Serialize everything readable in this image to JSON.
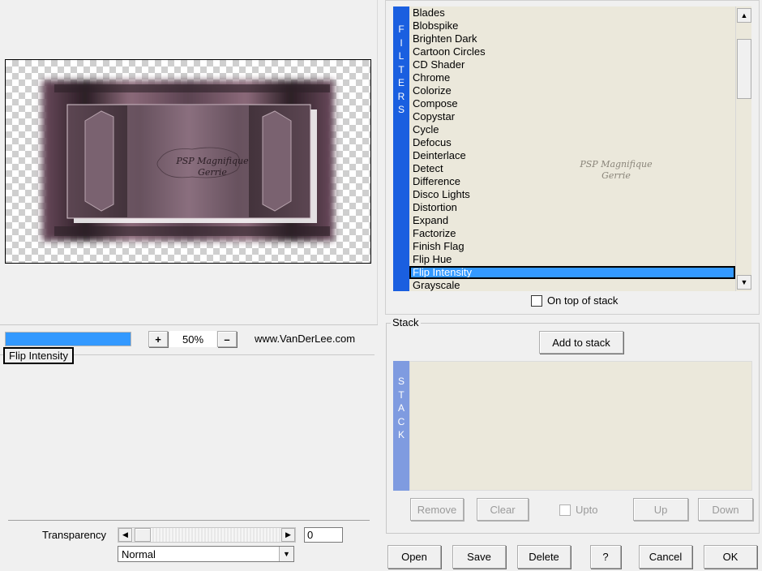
{
  "preview": {
    "zoom": "50%",
    "zoom_in": "+",
    "zoom_out": "–",
    "site": "www.VanDerLee.com",
    "progress": 1.0,
    "watermark_line1": "PSP Magnifique",
    "watermark_line2": "Gerrie"
  },
  "current_filter": "Flip Intensity",
  "filters": {
    "tab_letters": [
      "F",
      "I",
      "L",
      "T",
      "E",
      "R",
      "S"
    ],
    "items": [
      "Blades",
      "Blobspike",
      "Brighten Dark",
      "Cartoon Circles",
      "CD Shader",
      "Chrome",
      "Colorize",
      "Compose",
      "Copystar",
      "Cycle",
      "Defocus",
      "Deinterlace",
      "Detect",
      "Difference",
      "Disco Lights",
      "Distortion",
      "Expand",
      "Factorize",
      "Finish Flag",
      "Flip Hue",
      "Flip Intensity",
      "Grayscale"
    ],
    "selected": "Flip Intensity",
    "on_top_label": "On top of stack",
    "watermark_line1": "PSP Magnifique",
    "watermark_line2": "Gerrie"
  },
  "stack": {
    "title": "Stack",
    "add_label": "Add to stack",
    "tab_letters": [
      "S",
      "T",
      "A",
      "C",
      "K"
    ],
    "remove_label": "Remove",
    "clear_label": "Clear",
    "upto_label": "Upto",
    "up_label": "Up",
    "down_label": "Down"
  },
  "transparency": {
    "label": "Transparency",
    "value": "0",
    "blend_mode": "Normal"
  },
  "footer": {
    "open": "Open",
    "save": "Save",
    "delete": "Delete",
    "help": "?",
    "cancel": "Cancel",
    "ok": "OK"
  },
  "colors": {
    "filters_tab": "#1a5fe0",
    "stack_tab": "#7f9be0",
    "selection": "#3399ff",
    "list_bg": "#ebe8db"
  }
}
